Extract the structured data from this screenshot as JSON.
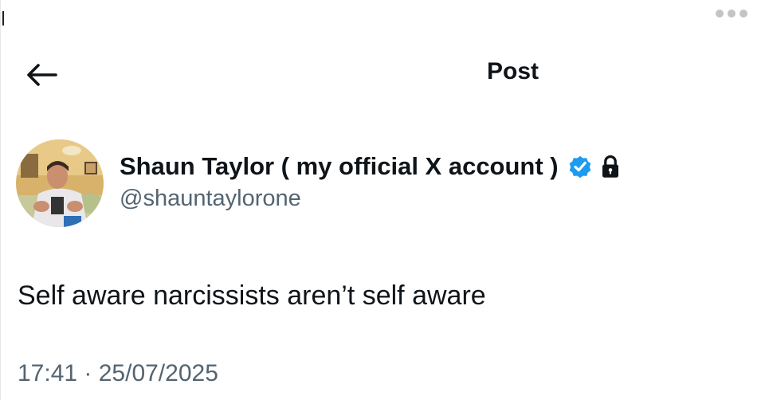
{
  "header": {
    "title": "Post",
    "back_icon": "arrow-left-icon",
    "more_icon": "more-dots-icon"
  },
  "author": {
    "display_name": "Shaun Taylor ( my official X account )",
    "handle": "@shauntaylorone",
    "verified_icon": "verified-badge-icon",
    "protected_icon": "lock-icon",
    "verified_color": "#1d9bf0"
  },
  "post": {
    "text": "Self aware narcissists aren’t self aware",
    "timestamp": "17:41 · 25/07/2025"
  },
  "colors": {
    "text_primary": "#0f1419",
    "text_secondary": "#536471",
    "background": "#ffffff"
  }
}
